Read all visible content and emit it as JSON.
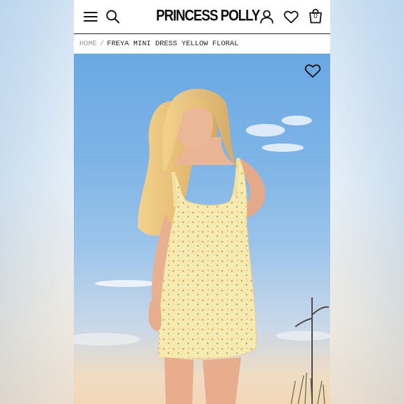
{
  "header": {
    "logo": "PRINCESS POLLY",
    "bag_count": "0",
    "menu_icon": "hamburger-menu-icon",
    "search_icon": "search-icon",
    "account_icon": "user-icon",
    "wishlist_icon": "heart-icon",
    "bag_icon": "shopping-bag-icon"
  },
  "breadcrumb": {
    "home": "HOME",
    "separator": "/",
    "current": "FREYA MINI DRESS YELLOW FLORAL"
  },
  "product_image": {
    "wishlist_icon": "heart-outline-icon"
  },
  "colors": {
    "sky_top": "#6aa8e3",
    "dress": "#f6eab0",
    "hair": "#e9c27c",
    "text": "#111111"
  }
}
